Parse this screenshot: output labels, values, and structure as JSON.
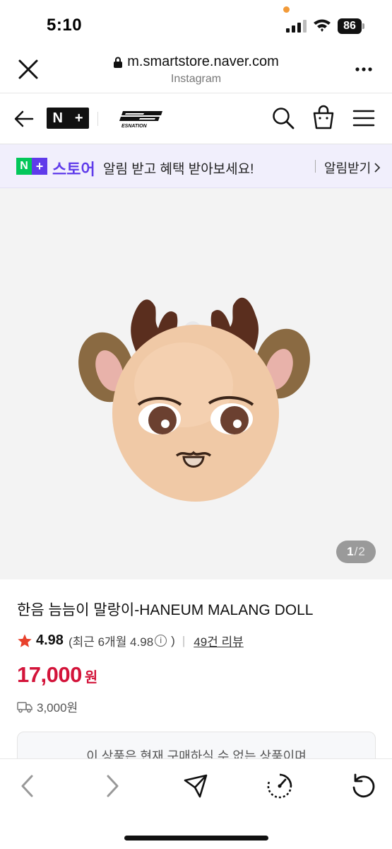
{
  "status_bar": {
    "time": "5:10",
    "battery": "86",
    "colors": {
      "recording_dot": "#f29a38"
    }
  },
  "browser": {
    "url": "m.smartstore.naver.com",
    "source": "Instagram",
    "icons": [
      "close-icon",
      "lock-icon",
      "more-icon"
    ]
  },
  "store_nav": {
    "logo_n": "N",
    "logo_plus": "+",
    "brand": "ESNATION",
    "icons": [
      "back-arrow-icon",
      "search-icon",
      "shopping-bag-icon",
      "menu-icon"
    ]
  },
  "notice": {
    "logo_n": "N",
    "logo_plus": "+",
    "store_label": "스토어",
    "message": "알림 받고 혜택 받아보세요!",
    "action": "알림받기",
    "colors": {
      "background": "#f1effc",
      "brand_purple": "#5f3bea",
      "naver_green": "#03c75a"
    }
  },
  "product": {
    "image_counter": {
      "current": "1",
      "separator": "/",
      "total": "2"
    },
    "title": "한음 늠늠이 말랑이-HANEUM MALANG DOLL",
    "rating": "4.98",
    "recent_rating_prefix": "(최근 6개월 4.98",
    "recent_rating_suffix": ")",
    "review_count": "49건 리뷰",
    "price": "17,000",
    "price_unit": "원",
    "shipping_fee": "3,000원",
    "unavailable_notice": "이 상품은 현재 구매하실 수 없는 상품이며",
    "colors": {
      "price": "#d3143a",
      "star": "#e8412c"
    }
  },
  "toolbar": {
    "icons": [
      "back-icon",
      "forward-icon",
      "share-icon",
      "speed-icon",
      "reload-icon"
    ]
  }
}
